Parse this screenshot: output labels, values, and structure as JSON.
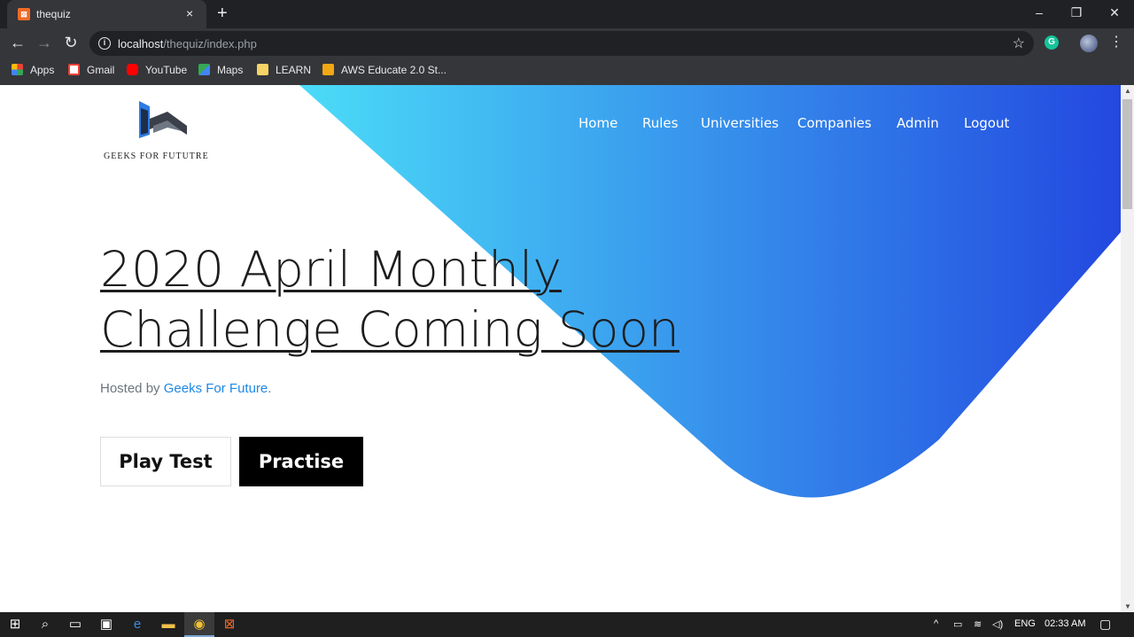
{
  "browser": {
    "tab_title": "thequiz",
    "tab_close": "×",
    "new_tab": "+",
    "url_host": "localhost",
    "url_path": "/thequiz/index.php",
    "window_controls": {
      "minimize": "–",
      "restore": "❐",
      "close": "✕"
    }
  },
  "bookmarks": [
    {
      "label": "Apps",
      "icon": "apps-grid-icon",
      "color": "#e94235"
    },
    {
      "label": "Gmail",
      "icon": "gmail-icon",
      "color": "#ea4335"
    },
    {
      "label": "YouTube",
      "icon": "youtube-icon",
      "color": "#ff0000"
    },
    {
      "label": "Maps",
      "icon": "maps-icon",
      "color": "#34a853"
    },
    {
      "label": "LEARN",
      "icon": "folder-icon",
      "color": "#f6d365"
    },
    {
      "label": "AWS Educate 2.0 St...",
      "icon": "aws-box-icon",
      "color": "#f3a712"
    }
  ],
  "site": {
    "logo_text": "GEEKS FOR FUTUTRE",
    "nav": [
      "Home",
      "Rules",
      "Universities",
      "Companies",
      "Admin",
      "Logout"
    ],
    "headline_line1": "2020 April Monthly",
    "headline_line2": "Challenge Coming Soon",
    "hosted_prefix": "Hosted by ",
    "hosted_link": "Geeks For Future",
    "hosted_suffix": ".",
    "btn_play": "Play Test",
    "btn_practise": "Practise",
    "gradient": {
      "from": "#4bdcf8",
      "to": "#2348e0"
    }
  },
  "taskbar": {
    "language": "ENG",
    "time": "02:33 AM"
  }
}
